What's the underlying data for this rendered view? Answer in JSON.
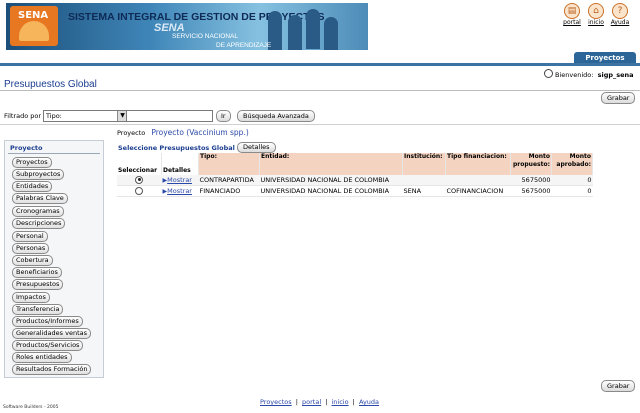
{
  "header": {
    "logo_text": "SENA",
    "system_title": "SISTEMA INTEGRAL DE GESTION DE PROYECTOS",
    "brand": "SENA",
    "brand_sub1": "SERVICIO NACIONAL",
    "brand_sub2": "DE APRENDIZAJE",
    "links": [
      {
        "label": "portal",
        "icon": "portal-icon"
      },
      {
        "label": "inicio",
        "icon": "home-icon"
      },
      {
        "label": "Ayuda",
        "icon": "help-icon"
      }
    ]
  },
  "tabs": {
    "active": "Proyectos"
  },
  "user": {
    "greeting": "Bienvenido:",
    "name": "sigp_sena"
  },
  "page": {
    "title": "Presupuestos Global"
  },
  "actions": {
    "save_top": "Grabar",
    "save_bottom": "Grabar"
  },
  "filter": {
    "label": "Filtrado por",
    "select_value": "Tipo:",
    "input_value": "",
    "go_button": "Ir",
    "advanced_button": "Búsqueda Avanzada"
  },
  "sidebar": {
    "heading": "Proyecto",
    "items": [
      "Proyectos",
      "Subproyectos",
      "Entidades",
      "Palabras Clave",
      "Cronogramas",
      "Descripciones",
      "Personal",
      "Personas",
      "Cobertura",
      "Beneficiarios",
      "Presupuestos",
      "Impactos",
      "Transferencia",
      "Productos/Informes",
      "Generalidades ventas",
      "Productos/Servicios",
      "Roles entidades",
      "Resultados Formación"
    ]
  },
  "main": {
    "project_label": "Proyecto",
    "project_value": "Proyecto (Vaccinium spp.)",
    "select_label": "Seleccione Presupuestos Global",
    "details_button": "Detalles",
    "table": {
      "headers": [
        "Seleccionar",
        "Detalles",
        "Tipo:",
        "Entidad:",
        "Institución:",
        "Tipo financiacion:",
        "Monto propuesto:",
        "Monto aprobado:"
      ],
      "rows": [
        {
          "selected": true,
          "detail": "Mostrar",
          "tipo": "CONTRAPARTIDA",
          "entidad": "UNIVERSIDAD NACIONAL DE COLOMBIA",
          "institucion": "",
          "financiacion": "",
          "propuesto": "5675000",
          "aprobado": "0"
        },
        {
          "selected": false,
          "detail": "Mostrar",
          "tipo": "FINANCIADO",
          "entidad": "UNIVERSIDAD NACIONAL DE COLOMBIA",
          "institucion": "SENA",
          "financiacion": "COFINANCIACION",
          "propuesto": "5675000",
          "aprobado": "0"
        }
      ]
    }
  },
  "footer": {
    "links": [
      "Proyectos",
      "portal",
      "inicio",
      "Ayuda"
    ],
    "separator": "|",
    "credit": "Software Builders - 2005"
  },
  "colors": {
    "accent": "#2c6698",
    "header_row": "#f4d3c0",
    "link": "#2a48a8",
    "logo": "#e87722"
  }
}
